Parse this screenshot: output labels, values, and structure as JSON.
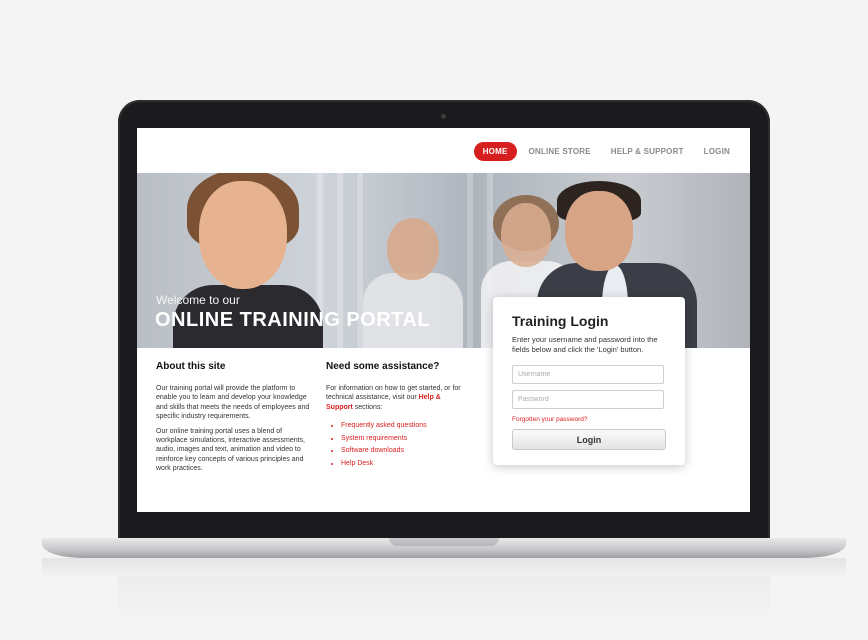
{
  "nav": {
    "items": [
      {
        "label": "HOME",
        "active": true
      },
      {
        "label": "ONLINE STORE",
        "active": false
      },
      {
        "label": "HELP & SUPPORT",
        "active": false
      },
      {
        "label": "LOGIN",
        "active": false
      }
    ]
  },
  "hero": {
    "welcome": "Welcome to our",
    "title": "ONLINE TRAINING PORTAL"
  },
  "login": {
    "title": "Training Login",
    "description": "Enter your username and password into the fields below and click the 'Login' button.",
    "username_placeholder": "Username",
    "password_placeholder": "Password",
    "forgot": "Forgotten your password?",
    "button": "Login"
  },
  "about": {
    "heading": "About this site",
    "p1": "Our training portal will provide the platform to enable you to learn and develop your knowledge and skills that meets the needs of employees and specific industry requirements.",
    "p2": "Our online training portal uses a blend of workplace simulations, interactive assessments, audio, images and text, animation and video to reinforce key concepts of various principles and work practices."
  },
  "help": {
    "heading": "Need some assistance?",
    "text_before": "For information on how to get started, or for technical assistance, visit our ",
    "link": "Help & Support",
    "text_after": " sections:",
    "links": [
      "Frequently asked questions",
      "System requirements",
      "Software downloads",
      "Help Desk"
    ]
  },
  "colors": {
    "accent": "#d81f1f",
    "bezel": "#1b1b1d"
  }
}
